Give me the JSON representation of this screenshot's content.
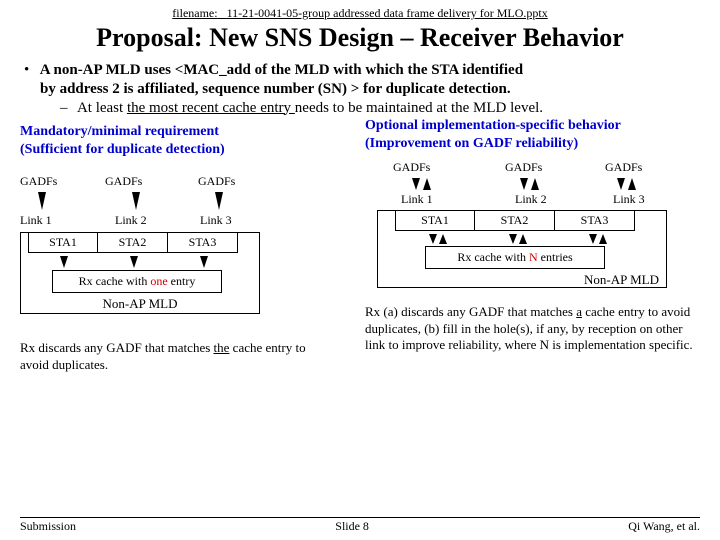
{
  "filename_prefix": "filename:",
  "filename": "11-21-0041-05-group addressed data frame delivery for MLO.pptx",
  "title": "Proposal: New SNS Design – Receiver Behavior",
  "bullet_main_l1": "A non-AP MLD uses  <MAC_add of the MLD with which the STA identified ",
  "bullet_main_l2": "by address 2 is affiliated,  sequence number (SN) >  for duplicate detection.",
  "sub_bullet_pre": "At least ",
  "sub_bullet_u": "the most recent cache entry ",
  "sub_bullet_post": "needs to be maintained at the MLD level.",
  "left": {
    "header_l1": "Mandatory/minimal requirement",
    "header_l2": "(Sufficient for duplicate detection)",
    "gadfs": "GADFs",
    "link1": "Link 1",
    "link2": "Link 2",
    "link3": "Link 3",
    "sta1": "STA1",
    "sta2": "STA2",
    "sta3": "STA3",
    "rx_cache_pre": "Rx cache with ",
    "rx_cache_em": "one",
    "rx_cache_post": " entry",
    "non_ap": "Non-AP MLD",
    "caption_pre": "Rx discards any GADF that matches ",
    "caption_u": "the",
    "caption_post": " cache entry to avoid duplicates."
  },
  "right": {
    "header_l1": "Optional implementation-specific behavior",
    "header_l2": "(Improvement on GADF reliability)",
    "gadfs": "GADFs",
    "link1": "Link 1",
    "link2": "Link 2",
    "link3": "Link 3",
    "sta1": "STA1",
    "sta2": "STA2",
    "sta3": "STA3",
    "rx_cache_pre": "Rx cache with ",
    "rx_cache_em": "N",
    "rx_cache_post": " entries",
    "non_ap": "Non-AP MLD",
    "caption_pre": "Rx (a) discards any GADF that matches ",
    "caption_u": "a",
    "caption_post": " cache entry to avoid duplicates, (b) fill in the hole(s), if any, by reception on other link to improve reliability,  where N is implementation specific."
  },
  "footer": {
    "left": "Submission",
    "center": "Slide 8",
    "right": "Qi Wang, et al."
  }
}
